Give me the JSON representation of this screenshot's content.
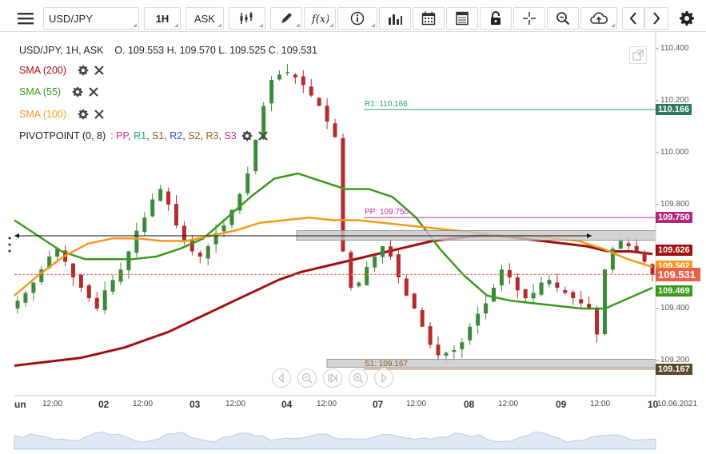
{
  "toolbar": {
    "symbol": "USD/JPY",
    "timeframe": "1H",
    "price_type": "ASK",
    "buttons": [
      "menu-icon",
      "symbol-select",
      "timeframe-select",
      "price-type-select",
      "chart-type-icon",
      "draw-icon",
      "function-icon",
      "info-icon",
      "volume-icon",
      "calendar-icon",
      "spreadsheet-icon",
      "lock-icon",
      "crosshair-icon",
      "zoom-icon",
      "cloud-upload-icon",
      "prev-icon",
      "next-icon",
      "settings-icon"
    ]
  },
  "header": {
    "instrument_line": "USD/JPY, 1H, ASK",
    "ohlc": "O. 109.553 H. 109.570 L. 109.525 C. 109.531"
  },
  "indicators": [
    {
      "label": "SMA (200)",
      "color": "#a01010"
    },
    {
      "label": "SMA (55)",
      "color": "#3a9a1a"
    },
    {
      "label": "SMA (100)",
      "color": "#f29a1c"
    }
  ],
  "pivot": {
    "label": "PIVOTPOINT (0, 8)",
    "components": [
      {
        "text": ": PP",
        "color": "#c0329a"
      },
      {
        "text": ", ",
        "color": "#222"
      },
      {
        "text": "R1",
        "color": "#20a070"
      },
      {
        "text": ", ",
        "color": "#222"
      },
      {
        "text": "S1",
        "color": "#8a5a2a"
      },
      {
        "text": ", ",
        "color": "#222"
      },
      {
        "text": "R2",
        "color": "#2050c0"
      },
      {
        "text": ", ",
        "color": "#222"
      },
      {
        "text": "S2",
        "color": "#8a5a2a"
      },
      {
        "text": ", ",
        "color": "#222"
      },
      {
        "text": "R3",
        "color": "#a06020"
      },
      {
        "text": ", ",
        "color": "#222"
      },
      {
        "text": "S3",
        "color": "#c0329a"
      }
    ]
  },
  "chart_data": {
    "type": "candlestick",
    "title": "USD/JPY, 1H, ASK",
    "ylim": [
      109.15,
      110.43
    ],
    "y_ticks": [
      110.4,
      110.2,
      110.0,
      109.8,
      109.4,
      109.2
    ],
    "y_tick_labels": [
      "110.400",
      "110.200",
      "110.000",
      "109.800",
      "109.400",
      "109.200"
    ],
    "x_ticks": [
      {
        "label": "un",
        "big": true
      },
      {
        "label": "12:00"
      },
      {
        "label": "02",
        "big": true
      },
      {
        "label": "12:00"
      },
      {
        "label": "03",
        "big": true
      },
      {
        "label": "12:00"
      },
      {
        "label": "04",
        "big": true
      },
      {
        "label": "12:00"
      },
      {
        "label": "07",
        "big": true
      },
      {
        "label": "12:00"
      },
      {
        "label": "08",
        "big": true
      },
      {
        "label": "12:00"
      },
      {
        "label": "09",
        "big": true
      },
      {
        "label": "12:00"
      },
      {
        "label": "10",
        "big": true
      },
      {
        "label": "10.06.2021"
      }
    ],
    "close_path": [
      109.43,
      109.46,
      109.5,
      109.55,
      109.6,
      109.63,
      109.58,
      109.52,
      109.48,
      109.44,
      109.4,
      109.47,
      109.51,
      109.55,
      109.62,
      109.7,
      109.75,
      109.82,
      109.86,
      109.8,
      109.72,
      109.66,
      109.62,
      109.6,
      109.64,
      109.69,
      109.72,
      109.78,
      109.84,
      109.92,
      110.05,
      110.18,
      110.28,
      110.3,
      110.31,
      110.29,
      110.26,
      110.22,
      110.18,
      110.12,
      110.06,
      109.62,
      109.48,
      109.5,
      109.56,
      109.6,
      109.64,
      109.6,
      109.52,
      109.45,
      109.4,
      109.33,
      109.26,
      109.22,
      109.23,
      109.24,
      109.27,
      109.33,
      109.38,
      109.42,
      109.48,
      109.55,
      109.52,
      109.47,
      109.44,
      109.46,
      109.5,
      109.51,
      109.48,
      109.46,
      109.44,
      109.42,
      109.4,
      109.3,
      109.55,
      109.63,
      109.66,
      109.64,
      109.62,
      109.58,
      109.53
    ],
    "sma200": [
      109.18,
      109.19,
      109.2,
      109.21,
      109.23,
      109.25,
      109.28,
      109.31,
      109.35,
      109.39,
      109.43,
      109.47,
      109.51,
      109.54,
      109.56,
      109.58,
      109.6,
      109.62,
      109.64,
      109.66,
      109.67,
      109.68,
      109.68,
      109.67,
      109.66,
      109.65,
      109.64,
      109.62,
      109.62,
      109.61
    ],
    "sma55": [
      109.74,
      109.68,
      109.62,
      109.59,
      109.59,
      109.59,
      109.6,
      109.63,
      109.67,
      109.75,
      109.83,
      109.9,
      109.92,
      109.89,
      109.86,
      109.86,
      109.83,
      109.75,
      109.63,
      109.53,
      109.45,
      109.43,
      109.42,
      109.41,
      109.4,
      109.4,
      109.44,
      109.48
    ],
    "sma100": [
      109.45,
      109.53,
      109.6,
      109.65,
      109.67,
      109.67,
      109.66,
      109.66,
      109.68,
      109.7,
      109.73,
      109.74,
      109.75,
      109.74,
      109.74,
      109.73,
      109.72,
      109.71,
      109.7,
      109.69,
      109.68,
      109.68,
      109.67,
      109.66,
      109.63,
      109.59,
      109.56
    ],
    "pivot_lines": [
      {
        "name": "R1",
        "label": "R1: 110.166",
        "value": 110.166,
        "color": "#20a070"
      },
      {
        "name": "PP",
        "label": "PP: 109.750",
        "value": 109.75,
        "color": "#c0329a"
      },
      {
        "name": "S1",
        "label": "S1: 109.167",
        "value": 109.167,
        "color": "#8a5a2a"
      }
    ],
    "price_tags": [
      {
        "text": "110.166",
        "value": 110.166,
        "color": "#2d7a5a"
      },
      {
        "text": "109.750",
        "value": 109.75,
        "color": "#b0287a"
      },
      {
        "text": "109.626",
        "value": 109.626,
        "color": "#a01010"
      },
      {
        "text": "109.562",
        "value": 109.562,
        "color": "#f29a1c"
      },
      {
        "text": "109.531",
        "value": 109.531,
        "color": "#e8624a"
      },
      {
        "text": "109.469",
        "value": 109.469,
        "color": "#3a9a1a"
      },
      {
        "text": "109.167",
        "value": 109.167,
        "color": "#5a4a2a"
      }
    ],
    "current_price": 109.531
  },
  "nav_buttons": [
    "chevron-left-icon",
    "zoom-out-icon",
    "reset-icon",
    "zoom-in-icon",
    "chevron-right-icon"
  ]
}
